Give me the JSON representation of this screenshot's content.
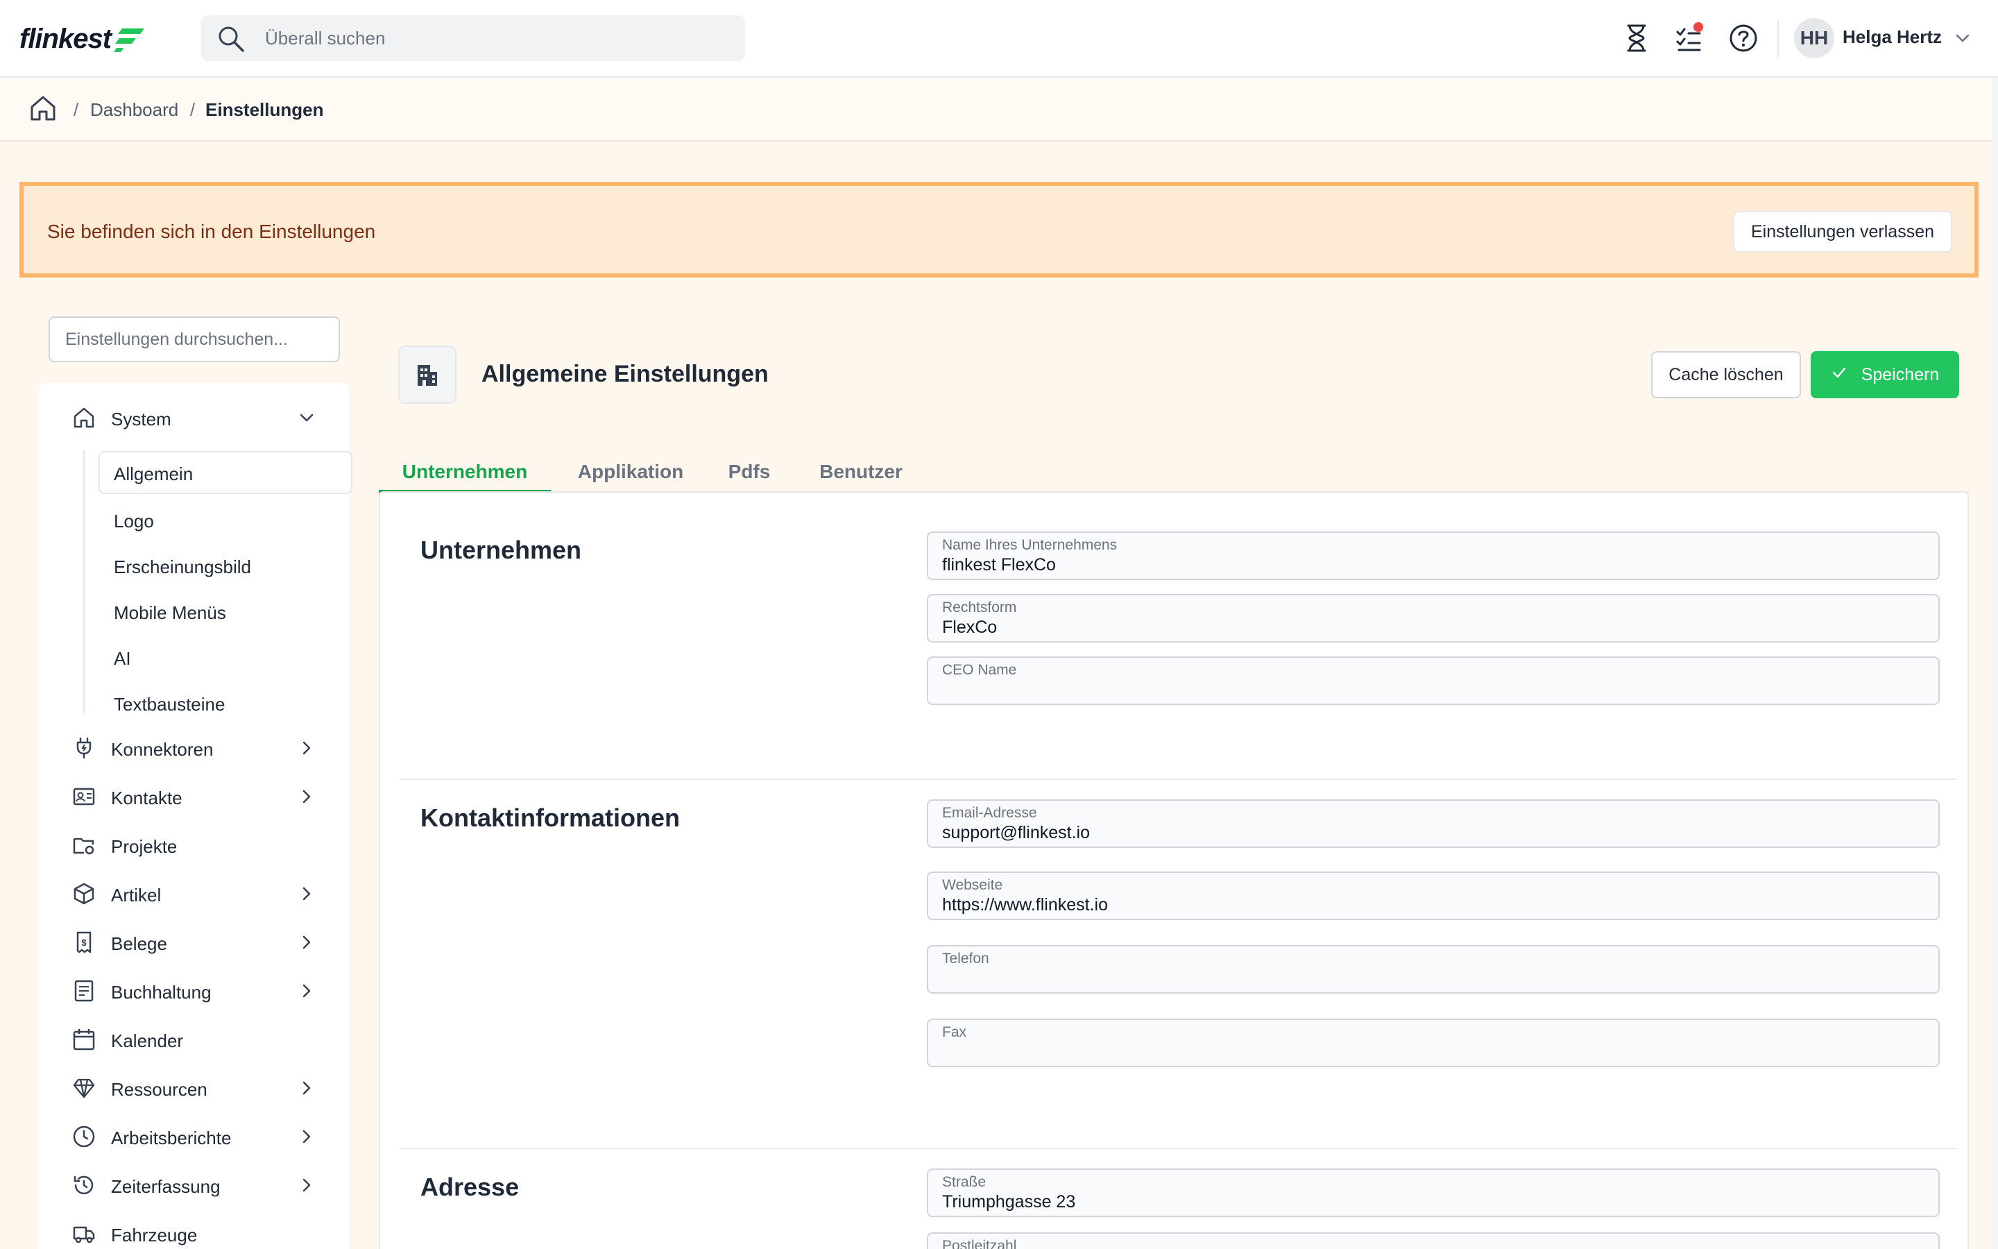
{
  "app": {
    "logo_text": "flinkest"
  },
  "header": {
    "search_placeholder": "Überall suchen",
    "user": {
      "initials": "HH",
      "name": "Helga Hertz"
    },
    "icons": [
      "hourglass-icon",
      "tasks-icon",
      "help-icon"
    ],
    "notification_color": "#ef4444"
  },
  "breadcrumb": {
    "items": [
      "Dashboard",
      "Einstellungen"
    ],
    "separator": "/"
  },
  "banner": {
    "text": "Sie befinden sich in den Einstellungen",
    "button": "Einstellungen verlassen"
  },
  "sidebar": {
    "search_placeholder": "Einstellungen durchsuchen...",
    "items": [
      {
        "label": "System",
        "icon": "home-icon",
        "expanded": true
      },
      {
        "label": "Konnektoren",
        "icon": "plug-icon"
      },
      {
        "label": "Kontakte",
        "icon": "contact-card-icon"
      },
      {
        "label": "Projekte",
        "icon": "folder-gear-icon"
      },
      {
        "label": "Artikel",
        "icon": "box-icon"
      },
      {
        "label": "Belege",
        "icon": "receipt-icon"
      },
      {
        "label": "Buchhaltung",
        "icon": "ledger-icon"
      },
      {
        "label": "Kalender",
        "icon": "calendar-icon"
      },
      {
        "label": "Ressourcen",
        "icon": "diamond-icon"
      },
      {
        "label": "Arbeitsberichte",
        "icon": "clock-icon"
      },
      {
        "label": "Zeiterfassung",
        "icon": "history-icon"
      },
      {
        "label": "Fahrzeuge",
        "icon": "truck-icon"
      }
    ],
    "system_sub": [
      "Allgemein",
      "Logo",
      "Erscheinungsbild",
      "Mobile Menüs",
      "AI",
      "Textbausteine"
    ],
    "active_sub": "Allgemein"
  },
  "main": {
    "title": "Allgemeine Einstellungen",
    "cache_button": "Cache löschen",
    "save_button": "Speichern",
    "accent": "#22c55e",
    "tabs": [
      "Unternehmen",
      "Applikation",
      "Pdfs",
      "Benutzer"
    ],
    "active_tab": "Unternehmen",
    "sections": {
      "company": {
        "title": "Unternehmen",
        "fields": [
          {
            "label": "Name Ihres Unternehmens",
            "value": "flinkest FlexCo"
          },
          {
            "label": "Rechtsform",
            "value": "FlexCo"
          },
          {
            "label": "CEO Name",
            "value": ""
          }
        ]
      },
      "contact": {
        "title": "Kontaktinformationen",
        "fields": [
          {
            "label": "Email-Adresse",
            "value": "support@flinkest.io"
          },
          {
            "label": "Webseite",
            "value": "https://www.flinkest.io"
          },
          {
            "label": "Telefon",
            "value": ""
          },
          {
            "label": "Fax",
            "value": ""
          }
        ]
      },
      "address": {
        "title": "Adresse",
        "fields": [
          {
            "label": "Straße",
            "value": "Triumphgasse 23"
          },
          {
            "label": "Postleitzahl",
            "value": ""
          }
        ]
      }
    }
  }
}
